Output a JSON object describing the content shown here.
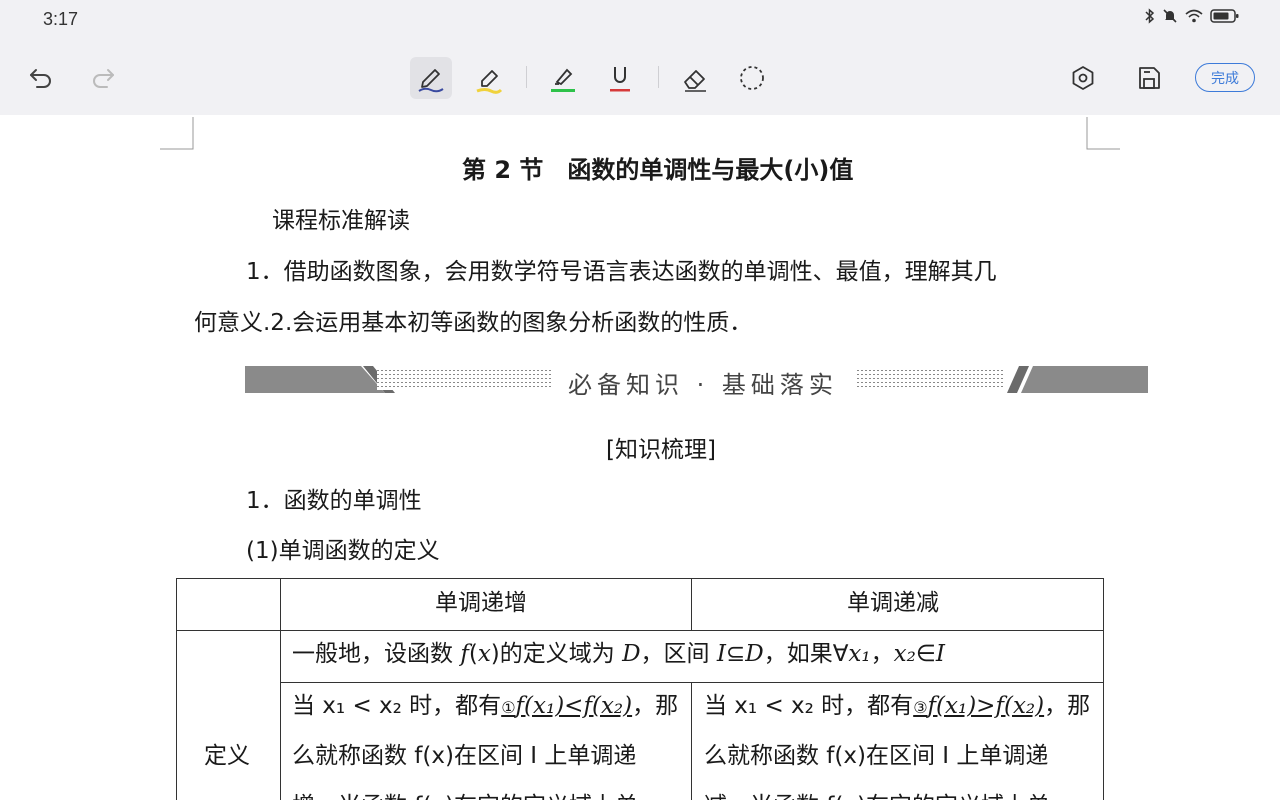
{
  "status_bar": {
    "time": "3:17",
    "icons": [
      "bluetooth-icon",
      "mute-icon",
      "wifi-icon",
      "battery-icon"
    ]
  },
  "toolbar": {
    "undo": "undo-icon",
    "redo": "redo-icon",
    "tools": [
      "pen-icon",
      "highlighter-icon",
      "text-highlight-icon",
      "underline-icon",
      "eraser-icon",
      "lasso-icon"
    ],
    "settings": "settings-icon",
    "save": "save-icon",
    "done_label": "完成",
    "colors": {
      "pen": "#3a4aa0",
      "highlighter": "#f0d23c",
      "text_highlight": "#2ec24a",
      "underline": "#d63a3a",
      "accent": "#3d7bd9"
    }
  },
  "document": {
    "title": "第 2 节　函数的单调性与最大(小)值",
    "standard_heading": "课程标准解读",
    "para_line1": "1．借助函数图象，会用数学符号语言表达函数的单调性、最值，理解其几",
    "para_line2": "何意义.2.会运用基本初等函数的图象分析函数的性质．",
    "banner": "必备知识 · 基础落实",
    "sub_heading": "[知识梳理]",
    "section1": "1．函数的单调性",
    "section1a": "(1)单调函数的定义",
    "table": {
      "col_inc": "单调递增",
      "col_dec": "单调递减",
      "row_label": "定义",
      "common": {
        "t1": "一般地，设函数 ",
        "fx": "f",
        "t2": "(",
        "x": "x",
        "t3": ")的定义域为 ",
        "D": "D",
        "t4": "，区间 ",
        "I": "I",
        "t5": "⊆",
        "D2": "D",
        "t6": "，如果∀",
        "x1": "x₁",
        "t7": "，",
        "x2": "x₂",
        "t8": "∈",
        "I2": "I"
      },
      "inc": {
        "l1_pre": "当 x₁ < x₂ 时，都有",
        "l1_mark": "①",
        "l1_expr": "f(x₁)<f(x₂)",
        "l1_post": "，那",
        "l2": "么就称函数 f(x)在区间 I 上单调递",
        "l3": "增，当函数 f(x)在它的定义域上单"
      },
      "dec": {
        "l1_pre": "当 x₁ < x₂ 时，都有",
        "l1_mark": "③",
        "l1_expr": "f(x₁)>f(x₂)",
        "l1_post": "，那",
        "l2": "么就称函数 f(x)在区间 I 上单调递",
        "l3": "减，当函数 f(x)在它的定义域上单"
      }
    }
  }
}
